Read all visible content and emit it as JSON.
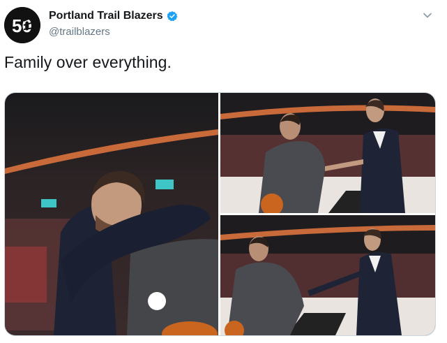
{
  "account": {
    "display_name": "Portland Trail Blazers",
    "handle": "@trailblazers",
    "avatar_text": "50",
    "verified": true
  },
  "tweet": {
    "text": "Family over everything."
  },
  "icons": {
    "verified": "verified-badge-icon",
    "menu": "chevron-down-icon"
  },
  "colors": {
    "verified_blue": "#1da1f2",
    "handle_gray": "#657786",
    "border": "#ccd6dd"
  }
}
